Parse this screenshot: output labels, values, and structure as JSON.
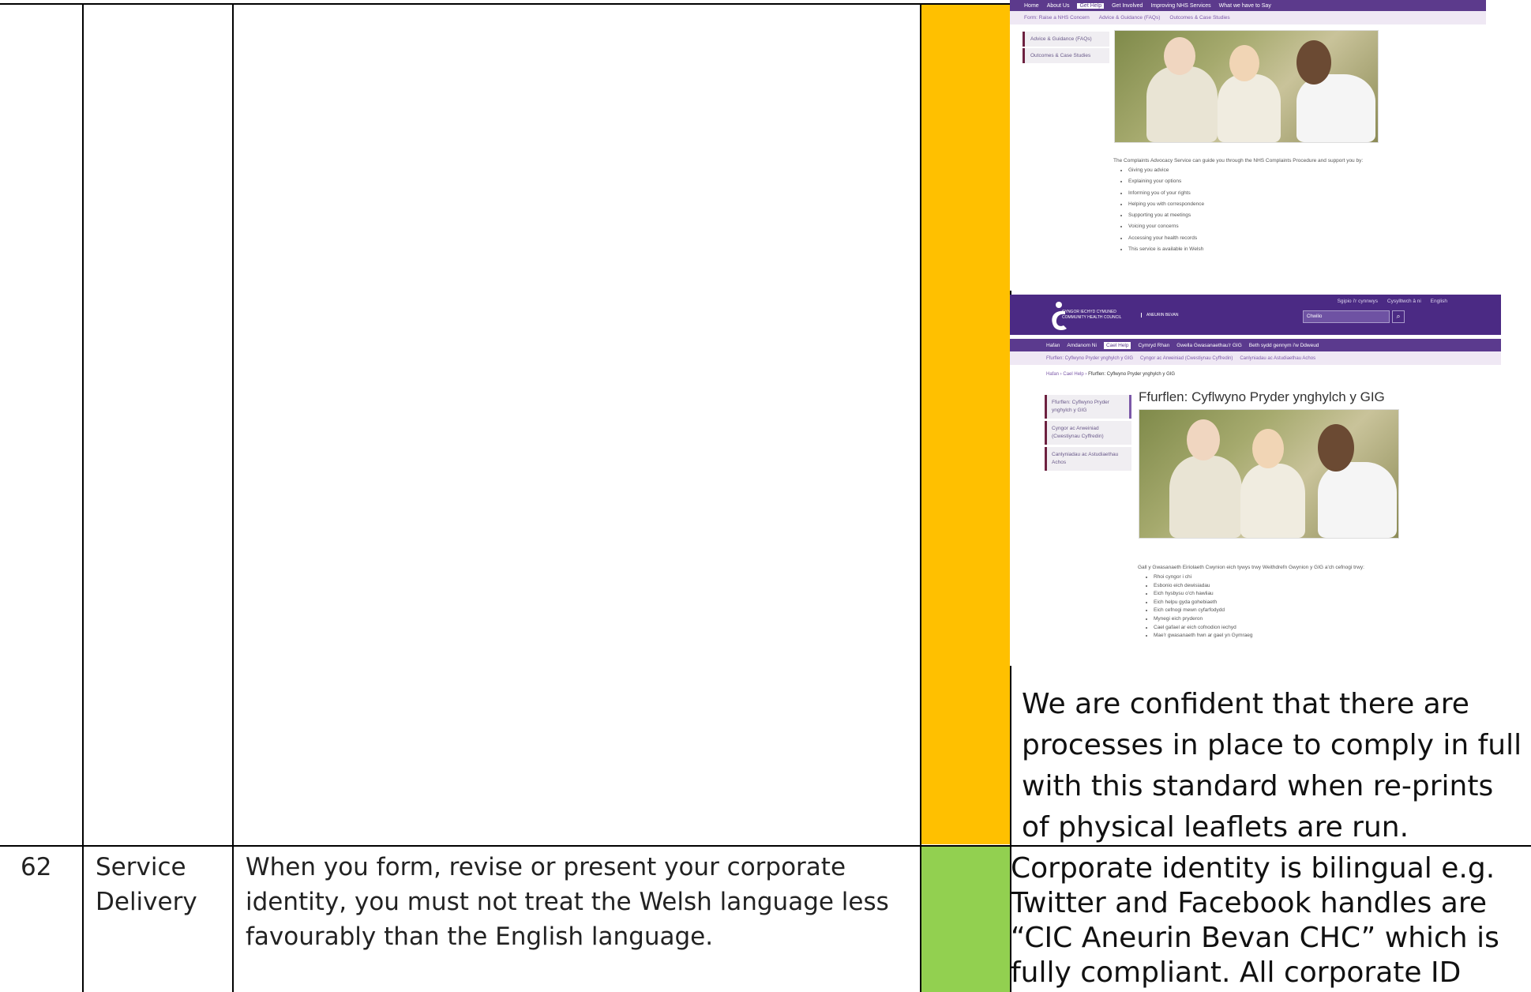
{
  "row_prev": {
    "rating_color": "#ffc000",
    "screenshot_en": {
      "nav": [
        "Home",
        "About Us",
        "Get Help",
        "Get Involved",
        "Improving NHS Services",
        "What we have to Say"
      ],
      "active_nav": "Get Help",
      "subnav": [
        "Form: Raise a NHS Concern",
        "Advice & Guidance (FAQs)",
        "Outcomes & Case Studies"
      ],
      "side": [
        "Advice & Guidance (FAQs)",
        "Outcomes & Case Studies"
      ],
      "intro": "The Complaints Advocacy Service can guide you through the NHS Complaints Procedure and support you by:",
      "bullets": [
        "Giving you advice",
        "Explaining your options",
        "Informing you of your rights",
        "Helping you with correspondence",
        "Supporting you at meetings",
        "Voicing your concerns",
        "Accessing your health records",
        "This service is available in Welsh"
      ]
    },
    "screenshot_cy": {
      "logo_line1": "CYNGOR IECHYD CYMUNED",
      "logo_line2": "COMMUNITY HEALTH COUNCIL",
      "logo_sub": "ANEURIN BEVAN",
      "top_links": [
        "Sgipio i'r cynnwys",
        "Cysylltwch â ni",
        "English"
      ],
      "search_placeholder": "Chwilio",
      "nav": [
        "Hafan",
        "Amdanom Ni",
        "Cael Help",
        "Cymryd Rhan",
        "Gwella Gwasanaethau'r GIG",
        "Beth sydd gennym i'w Ddweud"
      ],
      "active_nav": "Cael Help",
      "subnav": [
        "Ffurflen: Cyflwyno Pryder ynghylch y GIG",
        "Cyngor ac Arweiniad (Cwestiynau Cyffredin)",
        "Canlyniadau ac Astudiaethau Achos"
      ],
      "breadcrumb": [
        "Hafan",
        "Cael Help",
        "Ffurflen: Cyflwyno Pryder ynghylch y GIG"
      ],
      "side": [
        "Ffurflen: Cyflwyno Pryder ynghylch y GIG",
        "Cyngor ac Arweiniad (Cwestiynau Cyffredin)",
        "Canlyniadau ac Astudiaethau Achos"
      ],
      "title": "Ffurflen: Cyflwyno Pryder ynghylch y GIG",
      "intro": "Gall y Gwasanaeth Eiriolaeth Cwynion eich tywys trwy Weithdrefn Gwynion y GIG a'ch cefnogi trwy:",
      "bullets": [
        "Rhoi cyngor i chi",
        "Esbonio eich dewisiadau",
        "Eich hysbysu o'ch hawliau",
        "Eich helpu gyda gohebiaeth",
        "Eich cefnogi mewn cyfarfodydd",
        "Mynegi eich pryderon",
        "Cael gafael ar eich cofnodion iechyd",
        "Mae'r gwasanaeth hwn ar gael yn Gymraeg"
      ]
    },
    "comment": "We are confident that there are processes in place to comply in full with this standard when re-prints of physical leaflets are run."
  },
  "row_62": {
    "number": "62",
    "category": "Service Delivery",
    "standard": "When you form, revise or present your corporate identity, you must not treat the Welsh language less favourably than the English language.",
    "rating_color": "#92d050",
    "comment": "Corporate identity is bilingual e.g. Twitter and Facebook handles are “CIC Aneurin Bevan CHC” which is fully compliant. All corporate ID"
  }
}
